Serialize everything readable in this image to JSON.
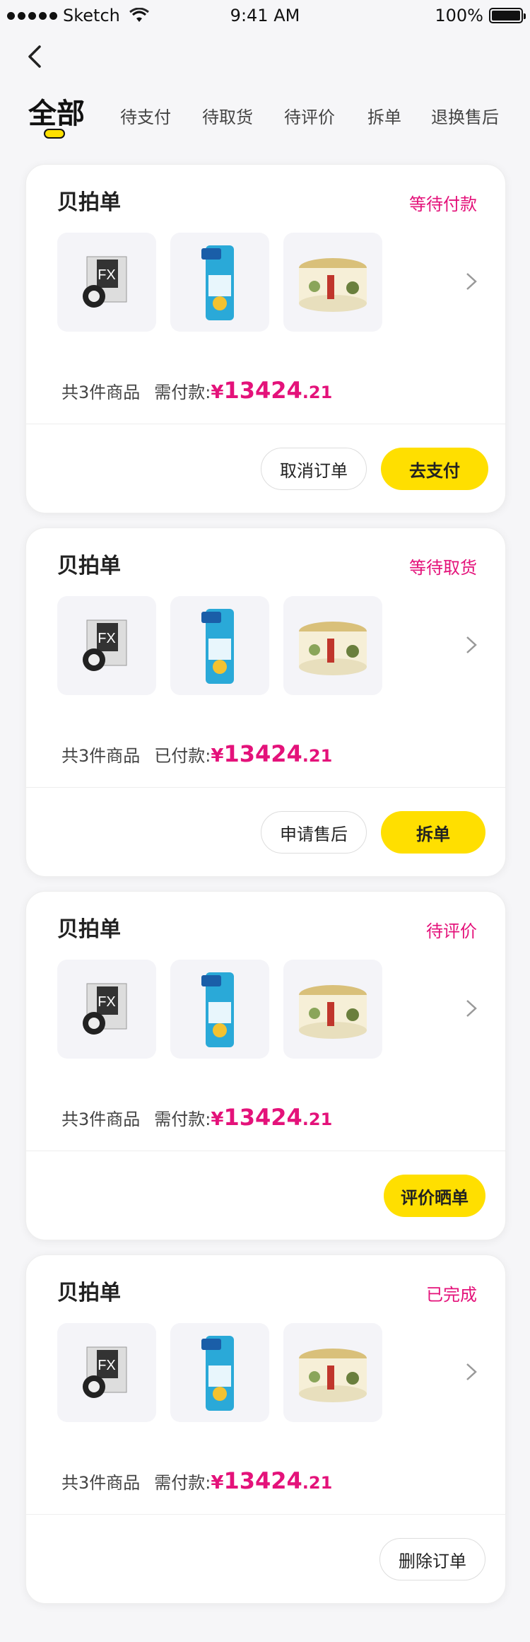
{
  "status_bar": {
    "carrier": "Sketch",
    "time": "9:41 AM",
    "battery": "100%",
    "battery_level": 1.0
  },
  "tabs": [
    {
      "label": "全部",
      "active": true
    },
    {
      "label": "待支付"
    },
    {
      "label": "待取货"
    },
    {
      "label": "待评价"
    },
    {
      "label": "拆单"
    },
    {
      "label": "退换售后"
    }
  ],
  "colors": {
    "accent": "#ffdf00",
    "status": "#e4127a"
  },
  "orders": [
    {
      "title": "贝拍单",
      "status": "等待付款",
      "count_text": "共3件商品",
      "pay_label": "需付款:",
      "price_int": "13424",
      "price_dec": ".21",
      "currency": "¥",
      "actions": [
        {
          "label": "取消订单",
          "style": "outline"
        },
        {
          "label": "去支付",
          "style": "primary"
        }
      ]
    },
    {
      "title": "贝拍单",
      "status": "等待取货",
      "count_text": "共3件商品",
      "pay_label": "已付款:",
      "price_int": "13424",
      "price_dec": ".21",
      "currency": "¥",
      "actions": [
        {
          "label": "申请售后",
          "style": "outline"
        },
        {
          "label": "拆单",
          "style": "primary"
        }
      ]
    },
    {
      "title": "贝拍单",
      "status": "待评价",
      "count_text": "共3件商品",
      "pay_label": "需付款:",
      "price_int": "13424",
      "price_dec": ".21",
      "currency": "¥",
      "actions": [
        {
          "label": "评价晒单",
          "style": "primary"
        }
      ]
    },
    {
      "title": "贝拍单",
      "status": "已完成",
      "count_text": "共3件商品",
      "pay_label": "需付款:",
      "price_int": "13424",
      "price_dec": ".21",
      "currency": "¥",
      "actions": [
        {
          "label": "删除订单",
          "style": "outline"
        }
      ]
    }
  ]
}
